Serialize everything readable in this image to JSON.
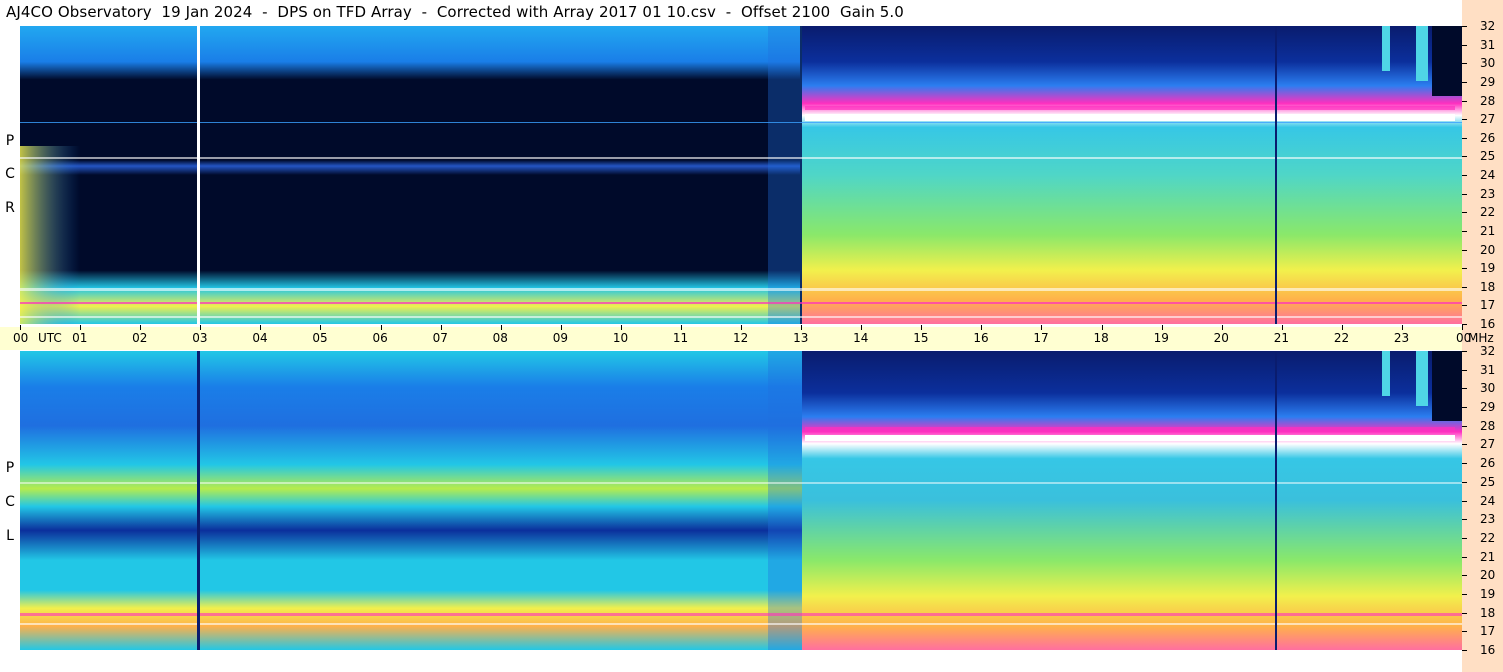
{
  "header": {
    "title": "AJ4CO Observatory  19 Jan 2024  -  DPS on TFD Array  -  Corrected with Array 2017 01 10.csv  -  Offset 2100  Gain 5.0"
  },
  "time_axis": {
    "labels": [
      "00",
      "01",
      "02",
      "03",
      "04",
      "05",
      "06",
      "07",
      "08",
      "09",
      "10",
      "11",
      "12",
      "13",
      "14",
      "15",
      "16",
      "17",
      "18",
      "19",
      "20",
      "21",
      "22",
      "23",
      "00"
    ],
    "start_unit": "UTC",
    "end_unit": "MHz"
  },
  "panels": [
    {
      "id": "rcp",
      "side_label": [
        "R",
        "C",
        "P"
      ]
    },
    {
      "id": "lcp",
      "side_label": [
        "L",
        "C",
        "P"
      ]
    }
  ],
  "freq_axis": {
    "labels": [
      "32",
      "31",
      "30",
      "29",
      "28",
      "27",
      "26",
      "25",
      "24",
      "23",
      "22",
      "21",
      "20",
      "19",
      "18",
      "17",
      "16"
    ]
  },
  "colors": {
    "background": "#ffffff",
    "utc_bar": "#ffffd2",
    "right_strip": "#ffdfc4",
    "dark_night": "#000a2a",
    "deep_blue": "#0b2f9c",
    "blue": "#1a7ee8",
    "cyan": "#22c7e6",
    "green": "#6ee06a",
    "yellow": "#f2f04c",
    "orange": "#ffb14a",
    "magenta": "#ff2fbf",
    "white": "#ffffff"
  },
  "chart_data": {
    "type": "heatmap",
    "title": "AJ4CO Observatory  19 Jan 2024  -  DPS on TFD Array  -  Corrected with Array 2017 01 10.csv  -  Offset 2100  Gain 5.0",
    "xlabel": "UTC",
    "ylabel": "MHz",
    "x_range": [
      0,
      24
    ],
    "y_range": [
      16,
      32
    ],
    "series": [
      {
        "name": "RCP"
      },
      {
        "name": "LCP"
      }
    ]
  }
}
